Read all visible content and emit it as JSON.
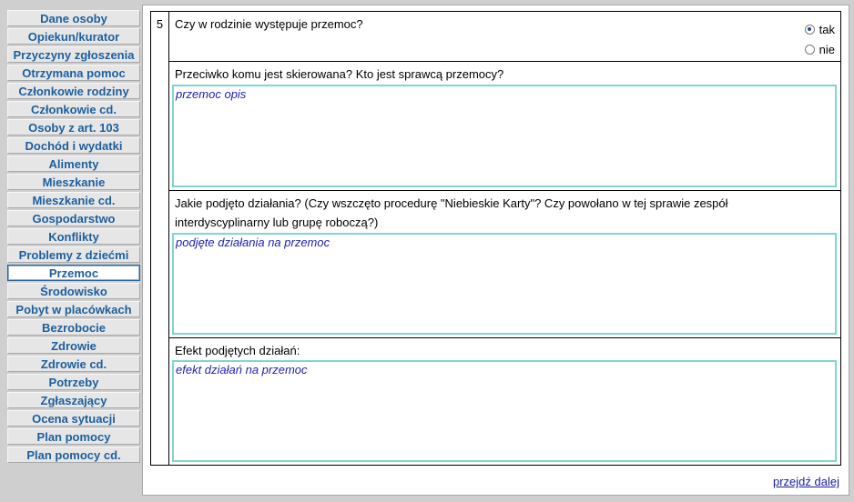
{
  "sidebar": {
    "items": [
      {
        "label": "Dane osoby"
      },
      {
        "label": "Opiekun/kurator"
      },
      {
        "label": "Przyczyny zgłoszenia"
      },
      {
        "label": "Otrzymana pomoc"
      },
      {
        "label": "Członkowie rodziny"
      },
      {
        "label": "Członkowie cd."
      },
      {
        "label": "Osoby z art. 103"
      },
      {
        "label": "Dochód i wydatki"
      },
      {
        "label": "Alimenty"
      },
      {
        "label": "Mieszkanie"
      },
      {
        "label": "Mieszkanie cd."
      },
      {
        "label": "Gospodarstwo"
      },
      {
        "label": "Konflikty"
      },
      {
        "label": "Problemy z dziećmi"
      },
      {
        "label": "Przemoc"
      },
      {
        "label": "Środowisko"
      },
      {
        "label": "Pobyt w placówkach"
      },
      {
        "label": "Bezrobocie"
      },
      {
        "label": "Zdrowie"
      },
      {
        "label": "Zdrowie cd."
      },
      {
        "label": "Potrzeby"
      },
      {
        "label": "Zgłaszający"
      },
      {
        "label": "Ocena sytuacji"
      },
      {
        "label": "Plan pomocy"
      },
      {
        "label": "Plan pomocy cd."
      }
    ],
    "active": "Przemoc"
  },
  "form": {
    "number": "5",
    "question": "Czy w rodzinie występuje przemoc?",
    "radio_yes": "tak",
    "radio_no": "nie",
    "selected": "tak",
    "q1_label": "Przeciwko komu jest skierowana? Kto jest sprawcą przemocy?",
    "q1_value": "przemoc opis",
    "q2_label_line1": "Jakie podjęto działania? (Czy wszczęto procedurę \"Niebieskie Karty\"? Czy powołano w tej sprawie zespół",
    "q2_label_line2": "interdyscyplinarny lub grupę roboczą?)",
    "q2_value": "podjęte działania na przemoc",
    "q3_label": "Efekt podjętych działań:",
    "q3_value": "efekt działań na przemoc"
  },
  "footer": {
    "next_label": "przejdź dalej"
  }
}
